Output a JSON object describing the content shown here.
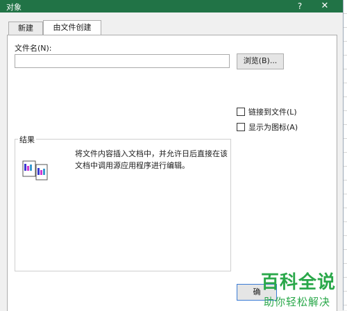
{
  "window": {
    "title": "对象",
    "help_label": "?",
    "close_label": "✕"
  },
  "tabs": [
    {
      "label": "新建",
      "active": false
    },
    {
      "label": "由文件创建",
      "active": true
    }
  ],
  "file_field": {
    "label": "文件名(N):",
    "value": "",
    "placeholder": ""
  },
  "browse_button": {
    "label": "浏览(B)..."
  },
  "options": {
    "link_to_file": {
      "label": "链接到文件(L)",
      "checked": false
    },
    "display_as_icon": {
      "label": "显示为图标(A)",
      "checked": false
    }
  },
  "result": {
    "legend": "结果",
    "description": "将文件内容插入文档中，并允许日后直接在该文档中调用源应用程序进行编辑。"
  },
  "ok_button": {
    "label": "确"
  },
  "watermark": {
    "main": "百科全说",
    "sub": "助你轻松解决"
  },
  "colors": {
    "titlebar": "#217346",
    "watermark": "#2aa84a",
    "panel_bg": "#ffffff",
    "dialog_bg": "#f0f0f0"
  }
}
